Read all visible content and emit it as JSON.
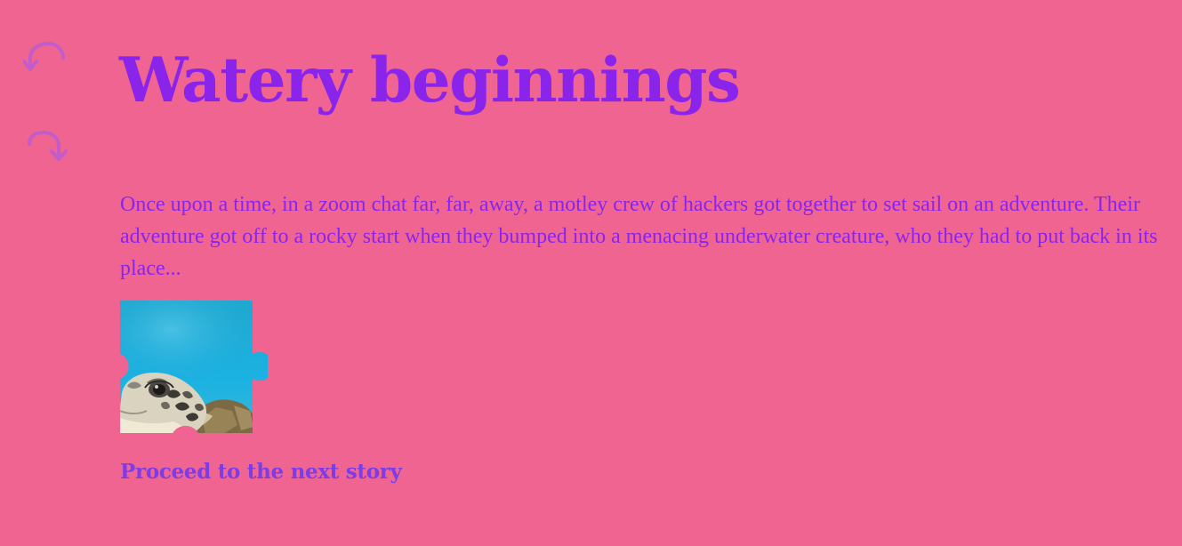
{
  "theme": {
    "background": "#f06492",
    "title_color": "#8b24ea",
    "text_color": "#8b24ea",
    "link_color": "#7c3ce6",
    "control_color": "#c25cc8"
  },
  "controls": {
    "undo_icon": "undo-arrow-icon",
    "redo_icon": "redo-arrow-icon"
  },
  "story": {
    "title": "Watery beginnings",
    "body": "Once upon a time, in a zoom chat far, far, away, a motley crew of hackers got together to set sail on an adventure. Their adventure got off to a rocky start when they bumped into a menacing underwater creature, who they had to put back in its place...",
    "puzzle_image": "sea-turtle-puzzle-piece",
    "next_link": "Proceed to the next story"
  }
}
